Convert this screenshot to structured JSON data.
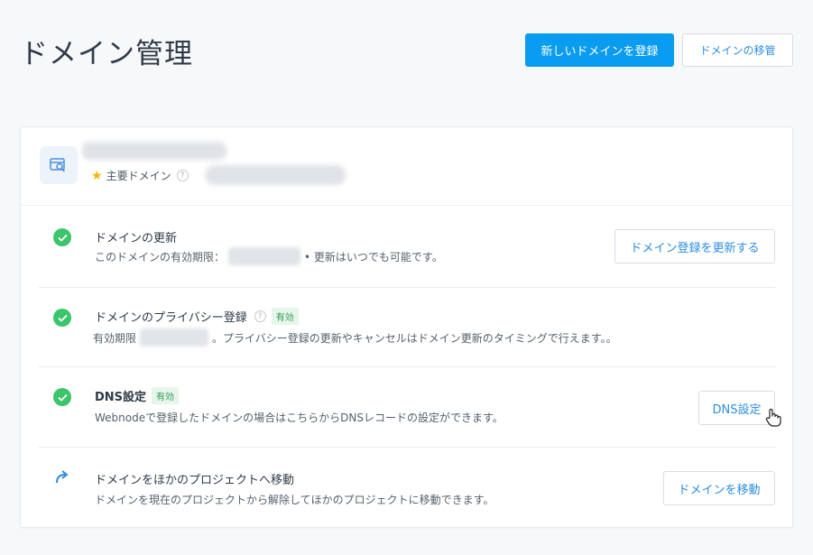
{
  "header": {
    "title": "ドメイン管理",
    "register_button": "新しいドメインを登録",
    "transfer_button": "ドメインの移管"
  },
  "domain": {
    "primary_label": "主要ドメイン",
    "help_symbol": "?"
  },
  "rows": [
    {
      "title": "ドメインの更新",
      "desc_before": "このドメインの有効期限：",
      "desc_after": "• 更新はいつでも可能です。",
      "button": "ドメイン登録を更新する"
    },
    {
      "title": "ドメインのプライバシー登録",
      "badge": "有効",
      "desc_before": "有効期限",
      "desc_after": "。プライバシー登録の更新やキャンセルはドメイン更新のタイミングで行えます。。"
    },
    {
      "title": "DNS設定",
      "badge": "有効",
      "desc": "Webnodeで登録したドメインの場合はこちらからDNSレコードの設定ができます。",
      "button": "DNS設定"
    },
    {
      "title": "ドメインをほかのプロジェクトへ移動",
      "desc": "ドメインを現在のプロジェクトから解除してほかのプロジェクトに移動できます。",
      "button": "ドメインを移動"
    }
  ],
  "colors": {
    "primary": "#0a9cf0",
    "success": "#3cc46b",
    "star": "#f5b400",
    "link": "#2c8ee0"
  }
}
